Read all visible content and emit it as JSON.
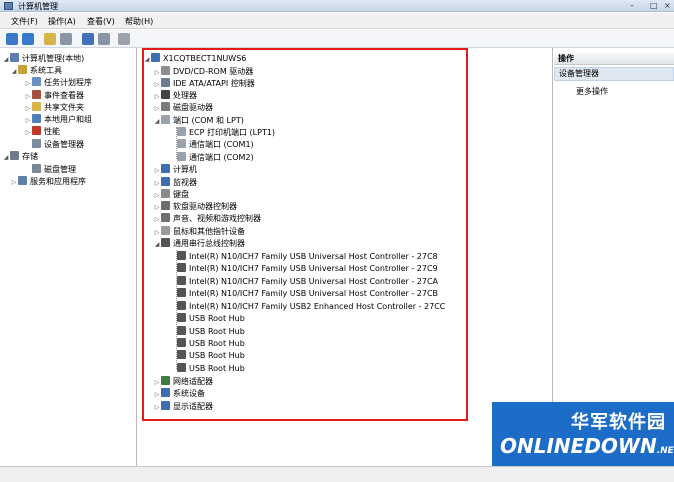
{
  "window": {
    "title": "计算机管理"
  },
  "menu": {
    "file": "文件(F)",
    "action": "操作(A)",
    "view": "查看(V)",
    "help": "帮助(H)"
  },
  "left_tree": [
    {
      "label": "计算机管理(本地)",
      "icon": "computer-management-icon",
      "color": "#5c7fae"
    },
    {
      "label": "系统工具",
      "icon": "tools-icon",
      "color": "#c9a13b"
    },
    {
      "label": "任务计划程序",
      "icon": "clock-icon",
      "color": "#6a8fc1"
    },
    {
      "label": "事件查看器",
      "icon": "event-viewer-icon",
      "color": "#a84f3f"
    },
    {
      "label": "共享文件夹",
      "icon": "shared-folder-icon",
      "color": "#d8b34a"
    },
    {
      "label": "本地用户和组",
      "icon": "users-icon",
      "color": "#4f7fb8"
    },
    {
      "label": "性能",
      "icon": "performance-icon",
      "color": "#c0392b"
    },
    {
      "label": "设备管理器",
      "icon": "device-manager-icon",
      "color": "#7b8a9c"
    },
    {
      "label": "存储",
      "icon": "storage-icon",
      "color": "#6c7a8a"
    },
    {
      "label": "磁盘管理",
      "icon": "disk-icon",
      "color": "#7a8796"
    },
    {
      "label": "服务和应用程序",
      "icon": "services-icon",
      "color": "#5d7fa8"
    }
  ],
  "device_tree": {
    "root": "X1CQTBECT1NUWS6",
    "items": [
      {
        "label": "DVD/CD-ROM 驱动器",
        "icon": "dvd-icon",
        "color": "#8d8d8d"
      },
      {
        "label": "IDE ATA/ATAPI 控制器",
        "icon": "ide-icon",
        "color": "#6b7d91"
      },
      {
        "label": "处理器",
        "icon": "cpu-icon",
        "color": "#444444"
      },
      {
        "label": "磁盘驱动器",
        "icon": "disk-drive-icon",
        "color": "#7b7b7b"
      },
      {
        "label": "端口 (COM 和 LPT)",
        "icon": "port-icon",
        "color": "#9aa3ad"
      },
      {
        "label": "ECP 打印机端口 (LPT1)",
        "icon": "port-icon",
        "color": "#9aa3ad"
      },
      {
        "label": "通信端口 (COM1)",
        "icon": "port-icon",
        "color": "#9aa3ad"
      },
      {
        "label": "通信端口 (COM2)",
        "icon": "port-icon",
        "color": "#9aa3ad"
      },
      {
        "label": "计算机",
        "icon": "computer-icon",
        "color": "#3d6db3"
      },
      {
        "label": "监视器",
        "icon": "monitor-icon",
        "color": "#3d6db3"
      },
      {
        "label": "键盘",
        "icon": "keyboard-icon",
        "color": "#8a8a8a"
      },
      {
        "label": "软盘驱动器控制器",
        "icon": "floppy-icon",
        "color": "#6d6d6d"
      },
      {
        "label": "声音、视频和游戏控制器",
        "icon": "sound-icon",
        "color": "#6f6f6f"
      },
      {
        "label": "鼠标和其他指针设备",
        "icon": "mouse-icon",
        "color": "#9a9a9a"
      },
      {
        "label": "通用串行总线控制器",
        "icon": "usb-icon",
        "color": "#555555"
      },
      {
        "label": "Intel(R) N10/ICH7 Family USB Universal Host Controller - 27C8",
        "icon": "usb-icon",
        "color": "#555555"
      },
      {
        "label": "Intel(R) N10/ICH7 Family USB Universal Host Controller - 27C9",
        "icon": "usb-icon",
        "color": "#555555"
      },
      {
        "label": "Intel(R) N10/ICH7 Family USB Universal Host Controller - 27CA",
        "icon": "usb-icon",
        "color": "#555555"
      },
      {
        "label": "Intel(R) N10/ICH7 Family USB Universal Host Controller - 27CB",
        "icon": "usb-icon",
        "color": "#555555"
      },
      {
        "label": "Intel(R) N10/ICH7 Family USB2 Enhanced Host Controller - 27CC",
        "icon": "usb-icon",
        "color": "#555555"
      },
      {
        "label": "USB Root Hub",
        "icon": "usb-icon",
        "color": "#555555"
      },
      {
        "label": "USB Root Hub",
        "icon": "usb-icon",
        "color": "#555555"
      },
      {
        "label": "USB Root Hub",
        "icon": "usb-icon",
        "color": "#555555"
      },
      {
        "label": "USB Root Hub",
        "icon": "usb-icon",
        "color": "#555555"
      },
      {
        "label": "USB Root Hub",
        "icon": "usb-icon",
        "color": "#555555"
      },
      {
        "label": "网络适配器",
        "icon": "network-icon",
        "color": "#3f7c3f"
      },
      {
        "label": "系统设备",
        "icon": "system-device-icon",
        "color": "#3d6db3"
      },
      {
        "label": "显示适配器",
        "icon": "display-adapter-icon",
        "color": "#3d6db3"
      }
    ]
  },
  "actions": {
    "header": "操作",
    "selected": "设备管理器",
    "more": "更多操作"
  },
  "watermark": {
    "cn": "华军软件园",
    "en": "ONLINEDOWN",
    "net": ".NET"
  },
  "colors": {
    "highlight_border": "#e21c1c",
    "watermark_bg": "#1d6cc7"
  }
}
